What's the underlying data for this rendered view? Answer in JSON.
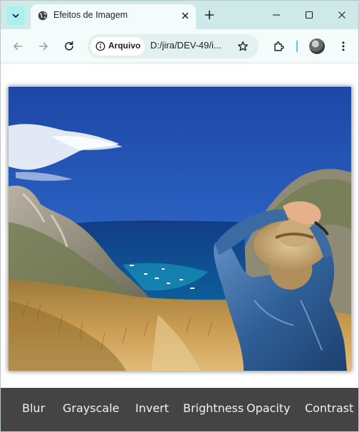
{
  "browser": {
    "tab_title": "Efeitos de Imagem",
    "site_chip_label": "Arquivo",
    "url": "D:/jira/DEV-49/i...",
    "icons": {
      "tab_search": "chevron-down-icon",
      "tab_favicon": "globe-icon",
      "tab_close": "close-icon",
      "new_tab": "plus-icon",
      "minimize": "minimize-icon",
      "maximize": "maximize-icon",
      "close_window": "close-icon",
      "back": "back-arrow-icon",
      "forward": "forward-arrow-icon",
      "reload": "reload-icon",
      "site_info": "info-icon",
      "bookmark": "star-icon",
      "extensions": "puzzle-icon",
      "menu": "kebab-menu-icon"
    },
    "colors": {
      "tabstrip": "#cde9e8",
      "toolbar": "#f4fbfb",
      "omnibox": "#e2f0ef"
    }
  },
  "page": {
    "image_alt": "Mulher de chapéu de palha olhando para uma baía azul entre penhascos",
    "filters": [
      {
        "label": "Blur"
      },
      {
        "label": "Grayscale"
      },
      {
        "label": "Invert"
      },
      {
        "label": "Brightness"
      },
      {
        "label": "Opacity"
      },
      {
        "label": "Contrast"
      }
    ],
    "colors": {
      "filterbar_bg": "#444444",
      "filter_text": "#f2f2f2"
    }
  }
}
